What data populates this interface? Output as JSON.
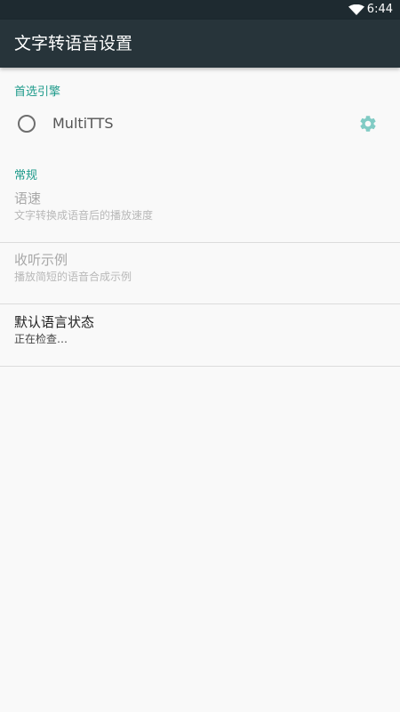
{
  "status_bar": {
    "time": "6:44",
    "icons": [
      "wifi-icon"
    ]
  },
  "app_bar": {
    "title": "文字转语音设置"
  },
  "preferred_engine": {
    "header": "首选引擎",
    "engines": [
      {
        "label": "MultiTTS",
        "selected": false,
        "settings_icon": "gear-icon"
      }
    ]
  },
  "general": {
    "header": "常规",
    "items": [
      {
        "title": "语速",
        "summary": "文字转换成语音后的播放速度",
        "enabled": false
      },
      {
        "title": "收听示例",
        "summary": "播放简短的语音合成示例",
        "enabled": false
      },
      {
        "title": "默认语言状态",
        "summary": "正在检查…",
        "enabled": true
      }
    ]
  },
  "colors": {
    "accent": "#1d9a8a",
    "app_bar": "#27343a",
    "status_bar": "#1e2a30",
    "background": "#f9f9f9"
  }
}
